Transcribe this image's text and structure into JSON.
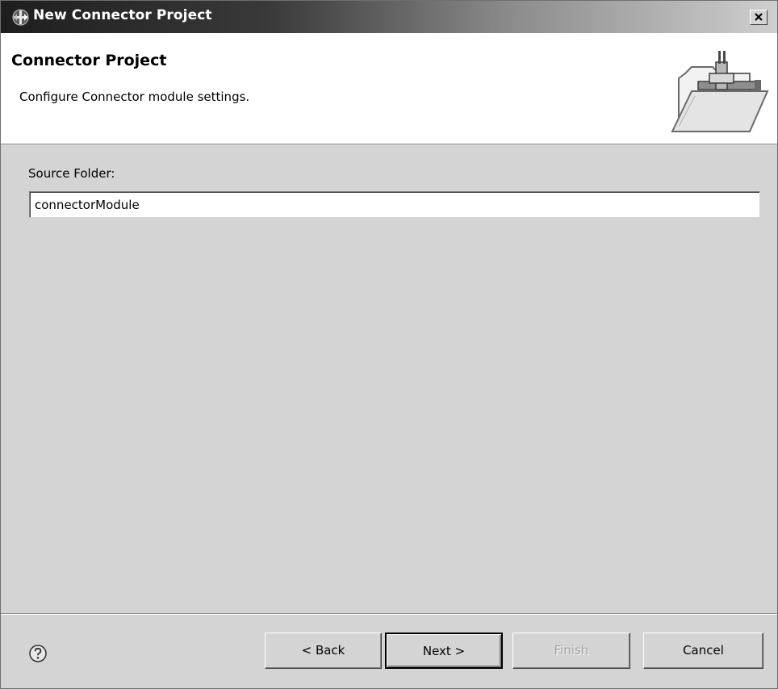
{
  "window": {
    "title": "New Connector Project",
    "icons": {
      "app": "connector-project-icon",
      "close": "close-icon"
    }
  },
  "banner": {
    "title": "Connector Project",
    "description": "Configure Connector module settings.",
    "icon": "folder-connector-icon"
  },
  "form": {
    "source_folder_label": "Source Folder:",
    "source_folder_value": "connectorModule"
  },
  "footer": {
    "help_icon": "help-icon",
    "buttons": {
      "back": "< Back",
      "next": "Next >",
      "finish": "Finish",
      "cancel": "Cancel"
    },
    "finish_enabled": false
  }
}
